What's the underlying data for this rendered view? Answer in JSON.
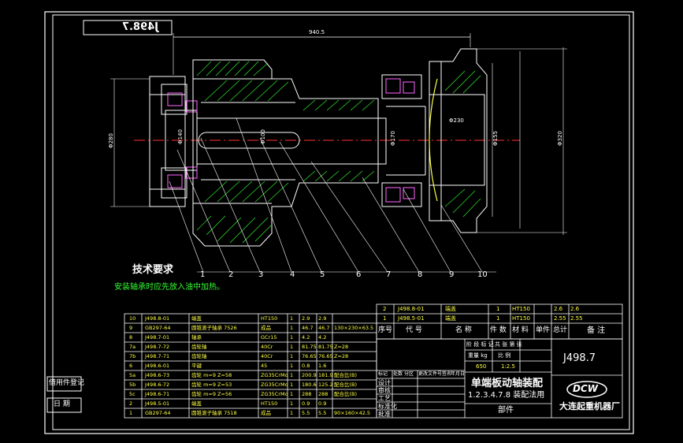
{
  "title_box": {
    "code_mirrored": "J498.7"
  },
  "dimensions": {
    "overall_length": "940.5",
    "left_dia": "Φ280",
    "bore_dia": "Φ140",
    "right_dia_a": "Φ170",
    "right_dia_b": "Φ155",
    "right_dia_c": "Φ320",
    "mid_note": "Φ100",
    "right_note": "Φ230"
  },
  "balloons": [
    "1",
    "2",
    "3",
    "4",
    "5",
    "6",
    "7",
    "8",
    "9",
    "10"
  ],
  "tech": {
    "heading": "技术要求",
    "note": "安装轴承时应先放入油中加热。"
  },
  "parts_list": {
    "rows": [
      {
        "no": "10",
        "code": "J498.8-01",
        "name": "端盖",
        "material": "HT150",
        "qty": "1",
        "unit": "2.9",
        "total": "2.9",
        "remark": ""
      },
      {
        "no": "9",
        "code": "GB297-64",
        "name": "圆锥滚子轴承 7526",
        "material": "成品",
        "qty": "1",
        "unit": "46.7",
        "total": "46.7",
        "remark": "130×230×63.5"
      },
      {
        "no": "8",
        "code": "J498.7-01",
        "name": "轴承",
        "material": "GCr15",
        "qty": "1",
        "unit": "4.2",
        "total": "4.2",
        "remark": ""
      },
      {
        "no": "7a",
        "code": "J498.7-72",
        "name": "齿轮轴",
        "material": "40Cr",
        "qty": "1",
        "unit": "81.75",
        "total": "81.75",
        "remark": "Z=28"
      },
      {
        "no": "7b",
        "code": "J498.7-71",
        "name": "齿轮轴",
        "material": "40Cr",
        "qty": "1",
        "unit": "76.65",
        "total": "76.65",
        "remark": "Z=28"
      },
      {
        "no": "6",
        "code": "J498.6-01",
        "name": "平键",
        "material": "45",
        "qty": "1",
        "unit": "0.8",
        "total": "1.6",
        "remark": ""
      },
      {
        "no": "5a",
        "code": "J498.6-73",
        "name": "齿轮 m=9 Z=58",
        "material": "ZG35CrMo",
        "qty": "1",
        "unit": "200.9",
        "total": "181.9",
        "remark": "配合比(B)"
      },
      {
        "no": "5b",
        "code": "J498.6-72",
        "name": "齿轮 m=9 Z=53",
        "material": "ZG35CrMo",
        "qty": "1",
        "unit": "180.6",
        "total": "125.2",
        "remark": "配合比(B)"
      },
      {
        "no": "5c",
        "code": "J498.6-71",
        "name": "齿轮 m=9 Z=56",
        "material": "ZG35CrMo",
        "qty": "1",
        "unit": "288",
        "total": "288",
        "remark": "配合比(B)"
      },
      {
        "no": "2",
        "code": "J498.5-01",
        "name": "端盖",
        "material": "HT150",
        "qty": "1",
        "unit": "0.9",
        "total": "0.9",
        "remark": ""
      },
      {
        "no": "1",
        "code": "GB297-64",
        "name": "圆锥滚子轴承 7518",
        "material": "成品",
        "qty": "1",
        "unit": "5.5",
        "total": "5.5",
        "remark": "90×160×42.5"
      }
    ]
  },
  "bom_top": {
    "rows": [
      {
        "no": "2",
        "code": "J498.8-01",
        "name": "端盖",
        "material": "HT150",
        "qty": "1",
        "unit": "2.6",
        "total": "2.6"
      },
      {
        "no": "1",
        "code": "J498.5-01",
        "name": "端盖",
        "material": "HT150",
        "qty": "1",
        "unit": "2.55",
        "total": "2.55"
      }
    ],
    "header": [
      "序号",
      "代  号",
      "名  称",
      "件 数",
      "材  料",
      "单件",
      "总计",
      "备 注"
    ]
  },
  "title_block": {
    "drawing_no": "J498.7",
    "product_name": "单端板动轴装配",
    "product_sub": "1.2.3.4.7.8 装配法用",
    "part_label": "部件",
    "company": "大连起重机器厂",
    "logo": "DCW",
    "stage_label": "阶 段 标 记",
    "weight_label": "重量 kg",
    "scale_label": "比 例",
    "sheet_label": "共 张 第 张",
    "weight_value": "650",
    "scale_value": "1:2.5",
    "roles": [
      "设计",
      "审核",
      "工艺",
      "标准化",
      "批准"
    ],
    "sig_cols": [
      "标记",
      "处数",
      "分区",
      "更改文件号",
      "签名",
      "年月日"
    ]
  },
  "left_side": {
    "label_top": "借用件登记",
    "label_bottom": "日  期"
  }
}
